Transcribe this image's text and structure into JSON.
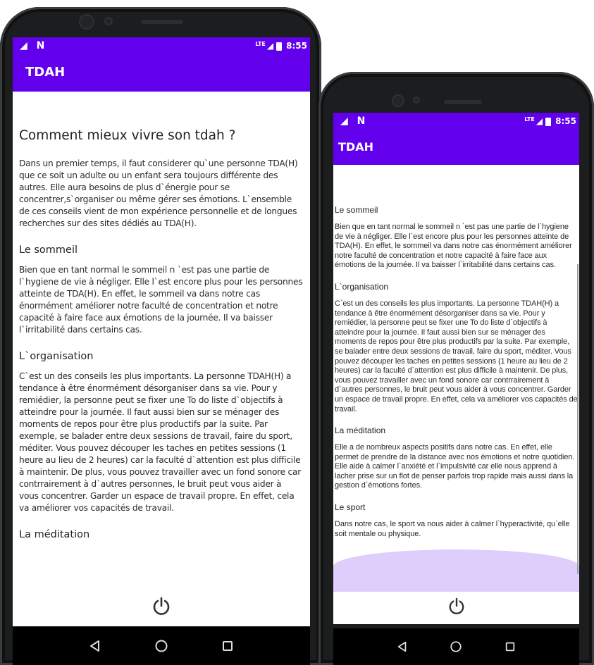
{
  "status": {
    "time": "8:55",
    "network": "LTE"
  },
  "app": {
    "title": "TDAH",
    "accent": "#6200ee"
  },
  "big": {
    "heading": "Comment mieux vivre son tdah ?",
    "intro": "Dans un premier temps, il faut considerer qu`une personne TDA(H) que ce soit un adulte ou un enfant sera toujours différente des autres. Elle aura besoins de plus d`énergie pour se concentrer,s`organiser ou même gérer ses émotions. L`ensemble de ces conseils vient de mon expérience personnelle et de longues recherches sur des sites dédiés au TDA(H).",
    "sections": [
      {
        "title": "Le sommeil",
        "text": "Bien que en tant normal le sommeil n `est pas une partie de l`hygiene de vie à négliger. Elle l`est encore plus pour les personnes atteinte de TDA(H). En effet, le sommeil va dans notre cas énormément améliorer notre faculté de concentration et notre capacité à faire face aux émotions de la journée. Il va baisser l`irritabilité dans certains cas."
      },
      {
        "title": "L`organisation",
        "text": "C`est un des conseils les plus importants. La personne TDAH(H) a tendance à être énormément désorganiser dans sa vie. Pour y remiédier, la personne peut se fixer une To do liste d`objectifs à atteindre pour la journée. Il faut aussi bien sur se ménager des moments de repos pour être plus productifs par la suite. Par exemple, se balader entre deux sessions de travail, faire du sport, méditer. Vous pouvez découper les taches en petites sessions (1 heure au lieu de 2 heures) car la faculté d`attention est plus difficile à maintenir. De plus, vous pouvez travailler avec un fond sonore car contrrairement à d`autres personnes, le bruit peut vous aider à vous concentrer. Garder un espace de travail propre. En effet, cela va améliorer vos capacités de travail."
      },
      {
        "title": "La méditation"
      }
    ]
  },
  "small": {
    "sections": [
      {
        "title": "Le sommeil",
        "text": "Bien que en tant normal le sommeil n `est pas une partie de l`hygiene de vie à négliger. Elle l`est encore plus pour les personnes atteinte de TDA(H). En effet, le sommeil va dans notre cas énormément améliorer notre faculté de concentration et notre capacité à faire face aux émotions de la journée. Il va baisser l`irritabilité dans certains cas."
      },
      {
        "title": "L`organisation",
        "text": "C`est un des conseils les plus importants. La personne TDAH(H) a tendance à être énormément désorganiser dans sa vie. Pour y remiédier, la personne peut se fixer une To do liste d`objectifs à atteindre pour la journée. Il faut aussi bien sur se ménager des moments de repos pour être plus productifs par la suite. Par exemple, se balader entre deux sessions de travail, faire du sport, méditer. Vous pouvez découper les taches en petites sessions (1 heure au lieu de 2 heures) car la faculté d`attention est plus difficile à maintenir. De plus, vous pouvez travailler avec un fond sonore car contrrairement à d`autres personnes, le bruit peut vous aider à vous concentrer. Garder un espace de travail propre. En effet, cela va améliorer vos capacités de travail."
      },
      {
        "title": "La méditation",
        "text": "Elle a de nombreux aspects positifs dans notre cas. En effet, elle permet de prendre de la distance avec nos émotions et notre quotidien. Elle aide à calmer l`anxiété et l`impulsivité car elle nous apprend à lacher prise sur un flot de penser parfois trop rapide mais aussi dans la gestion d`émotions fortes."
      },
      {
        "title": "Le sport",
        "text": "Dans notre cas, le sport va nous aider à calmer l`hyperactivité, qu`elle soit mentale ou physique."
      }
    ]
  },
  "icons": {
    "power": "power-icon",
    "back": "back-triangle-icon",
    "home": "home-circle-icon",
    "recents": "recents-square-icon"
  }
}
